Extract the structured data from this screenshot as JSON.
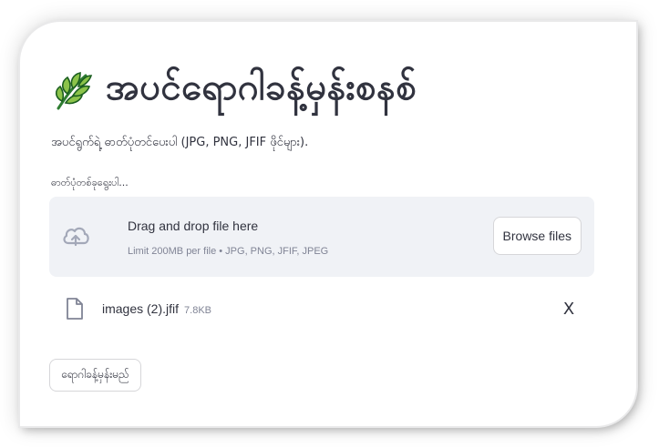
{
  "header": {
    "icon": "herb-leaf-icon",
    "title": "အပင်ရောဂါခန့်မှန်းစနစ်"
  },
  "subtitle": "အပင်ရွက်ရဲ့ ဓာတ်ပုံတင်ပေးပါ (JPG, PNG, JFIF ဖိုင်များ).",
  "uploader": {
    "label": "ဓာတ်ပုံတစ်ခုရွေးပါ...",
    "icon": "cloud-upload-icon",
    "drop_text": "Drag and drop file here",
    "limit_text": "Limit 200MB per file • JPG, PNG, JFIF, JPEG",
    "browse_label": "Browse files"
  },
  "uploaded_file": {
    "icon": "file-icon",
    "name": "images (2).jfif",
    "size": "7.8KB",
    "remove_icon": "close-icon",
    "remove_label": "X"
  },
  "actions": {
    "predict_label": "ရောဂါခန့်မှန်းမည်"
  },
  "colors": {
    "leaf_dark": "#2e7d32",
    "leaf_light": "#8bc34a",
    "dropzone_bg": "#f0f2f6",
    "text": "#31333f",
    "muted": "#808495"
  }
}
